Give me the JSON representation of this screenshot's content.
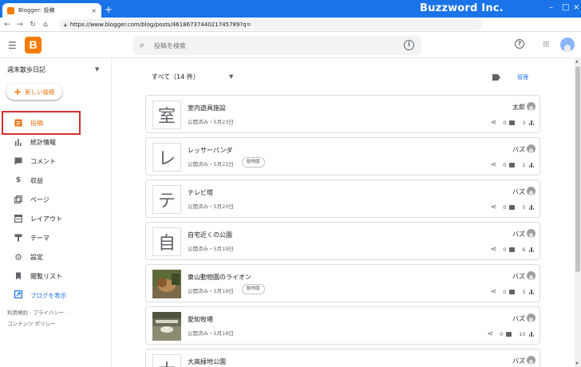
{
  "browser": {
    "tab_title": "Blogger: 投稿",
    "tab_close": "×",
    "new_tab": "+",
    "url": "https://www.blogger.com/blog/posts/4618673744021745789?q=",
    "watermark": "Buzzword Inc.",
    "colors": {
      "titlebar": "#1a73e8"
    }
  },
  "header": {
    "logo": "B",
    "search_placeholder": "投稿を検索"
  },
  "sidebar": {
    "blog_name": "週末散歩日記",
    "new_post": "新しい投稿",
    "items": [
      {
        "label": "投稿",
        "icon": "posts-icon",
        "active": true
      },
      {
        "label": "統計情報",
        "icon": "stats-icon",
        "active": false
      },
      {
        "label": "コメント",
        "icon": "comment-icon",
        "active": false
      },
      {
        "label": "収益",
        "icon": "dollar-icon",
        "active": false
      },
      {
        "label": "ページ",
        "icon": "pages-icon",
        "active": false
      },
      {
        "label": "レイアウト",
        "icon": "layout-icon",
        "active": false
      },
      {
        "label": "テーマ",
        "icon": "theme-icon",
        "active": false
      },
      {
        "label": "設定",
        "icon": "gear-icon",
        "active": false
      },
      {
        "label": "閲覧リスト",
        "icon": "bookmark-icon",
        "active": false
      }
    ],
    "view_blog": "ブログを表示",
    "footer_line1": "利用規約 · プライバシー ·",
    "footer_line2": "コンテンツ ポリシー"
  },
  "main": {
    "filter": "すべて（14 件）",
    "manage": "管理",
    "posts": [
      {
        "title": "室内遊具施設",
        "thumb": "室",
        "meta": "公開済み・5月23日",
        "label": "",
        "author": "太郎",
        "comments": "0",
        "views": "3",
        "photo": false
      },
      {
        "title": "レッサーパンダ",
        "thumb": "レ",
        "meta": "公開済み・5月22日",
        "label": "動物園",
        "author": "バズ",
        "comments": "0",
        "views": "1",
        "photo": false
      },
      {
        "title": "テレビ塔",
        "thumb": "テ",
        "meta": "公開済み・5月20日",
        "label": "",
        "author": "バズ",
        "comments": "0",
        "views": "5",
        "photo": false
      },
      {
        "title": "自宅近くの公園",
        "thumb": "自",
        "meta": "公開済み・5月19日",
        "label": "",
        "author": "バズ",
        "comments": "0",
        "views": "6",
        "photo": false
      },
      {
        "title": "東山動物園のライオン",
        "thumb": "",
        "meta": "公開済み・5月19日",
        "label": "動物園",
        "author": "バズ",
        "comments": "0",
        "views": "5",
        "photo": true
      },
      {
        "title": "愛知牧場",
        "thumb": "",
        "meta": "公開済み・5月18日",
        "label": "",
        "author": "バズ",
        "comments": "0",
        "views": "10",
        "photo": true
      },
      {
        "title": "大高緑地公園",
        "thumb": "大",
        "meta": "",
        "label": "",
        "author": "バズ",
        "comments": "",
        "views": "",
        "photo": false
      }
    ]
  }
}
